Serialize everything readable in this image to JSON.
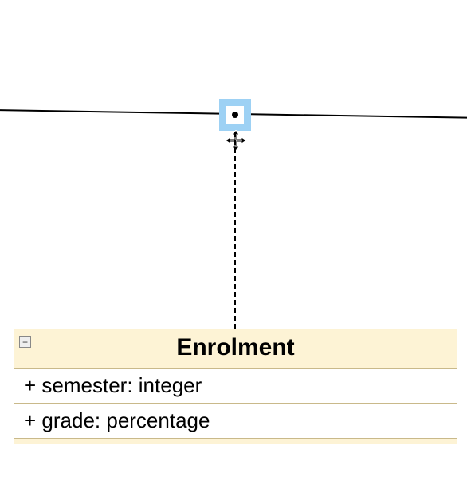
{
  "diagram": {
    "type": "uml-class-diagram-fragment",
    "connection_point": {
      "selected": true,
      "cursor": "move"
    },
    "association_line": {
      "present": true
    },
    "dependency_to_class": {
      "style": "dashed"
    },
    "class": {
      "name": "Enrolment",
      "collapse_glyph": "−",
      "attributes": [
        {
          "visibility": "+",
          "name": "semester",
          "type": "integer"
        },
        {
          "visibility": "+",
          "name": "grade",
          "type": "percentage"
        }
      ],
      "attr_display": [
        "+ semester: integer",
        "+ grade: percentage"
      ]
    }
  }
}
